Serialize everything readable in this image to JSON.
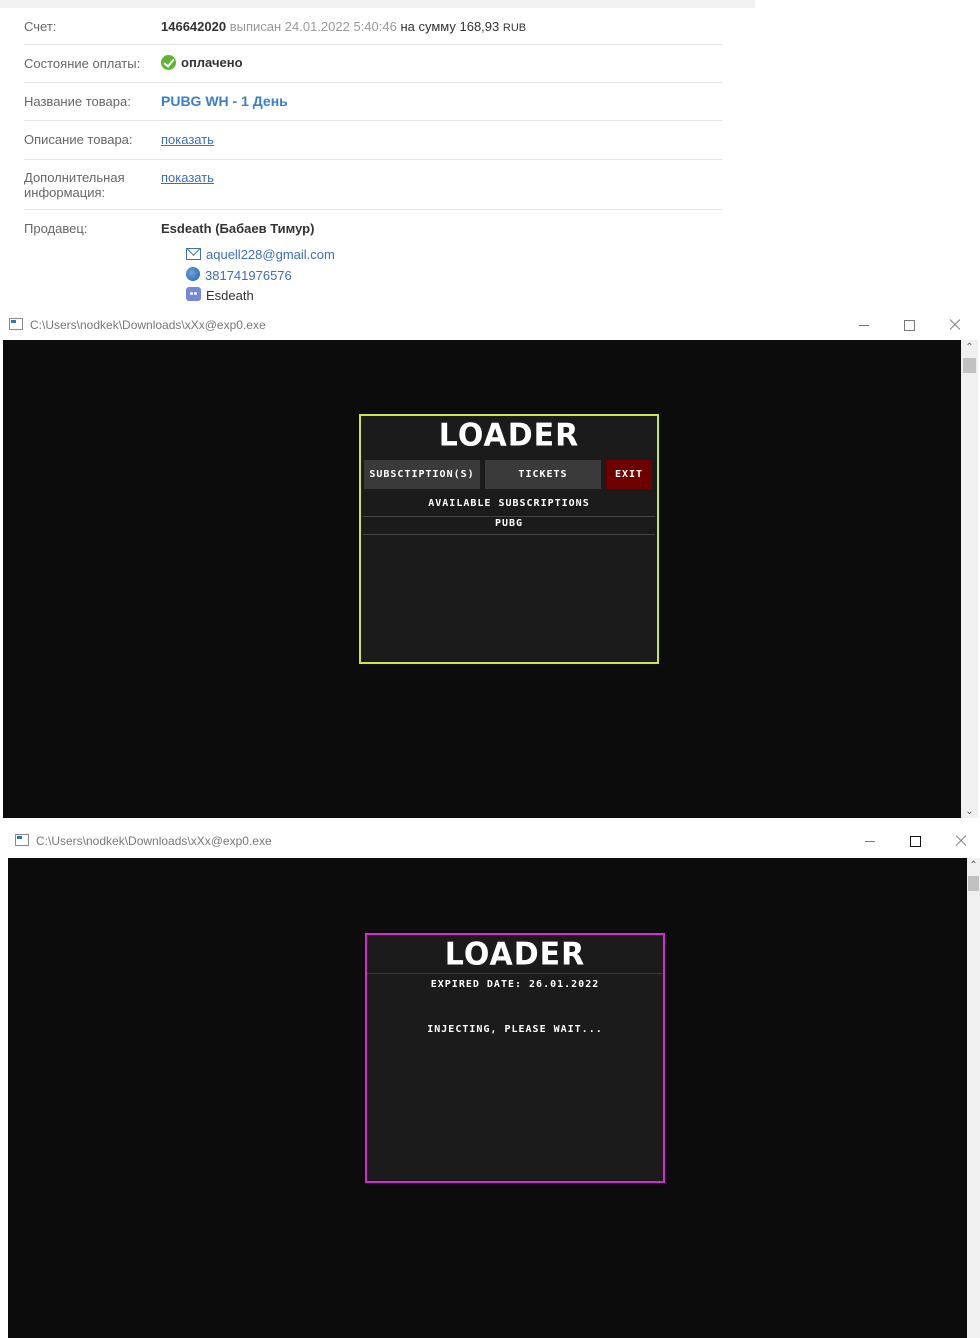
{
  "invoice": {
    "invoice_label": "Счет:",
    "invoice_number": "146642020",
    "issued_text": "выписан 24.01.2022 5:40:46",
    "amount_prefix": "на сумму",
    "amount": "168,93",
    "currency": "RUB",
    "payment_state_label": "Состояние оплаты:",
    "payment_state": "оплачено",
    "product_name_label": "Название товара:",
    "product_name": "PUBG WH - 1 День",
    "product_desc_label": "Описание товара:",
    "product_desc_link": "показать",
    "extra_info_label_line1": "Дополнительная",
    "extra_info_label_line2": "информация:",
    "extra_info_link": "показать",
    "seller_label": "Продавец:",
    "seller_name": "Esdeath",
    "seller_fullname": "(Бабаев Тимур)",
    "email": "aquell228@gmail.com",
    "wmid": "381741976576",
    "discord": "Esdeath"
  },
  "window1": {
    "title": "C:\\Users\\nodkek\\Downloads\\xXx@exp0.exe",
    "loader": {
      "title": "LOADER",
      "btn_subscriptions": "SUBSCTIPTION(S)",
      "btn_tickets": "TICKETS",
      "btn_exit": "EXIT",
      "section_header": "AVAILABLE SUBSCRIPTIONS",
      "items": [
        "PUBG"
      ],
      "border_color": "#c8e64a"
    }
  },
  "window2": {
    "title": "C:\\Users\\nodkek\\Downloads\\xXx@exp0.exe",
    "loader": {
      "title": "LOADER",
      "expired": "EXPIRED DATE: 26.01.2022",
      "status": "INJECTING, PLEASE WAIT...",
      "border_color": "#d42ad4"
    }
  },
  "colors": {
    "console_bg": "#0c0c0c",
    "loader_bg": "#1b1b1b",
    "exit_red": "#6e0000",
    "link_blue": "#3c6fb4",
    "ok_green": "#5cb531"
  },
  "icons": {
    "ok": "check-circle-icon",
    "email": "envelope-icon",
    "wmid": "webmoney-globe-icon",
    "discord": "discord-icon",
    "app": "console-app-icon"
  }
}
